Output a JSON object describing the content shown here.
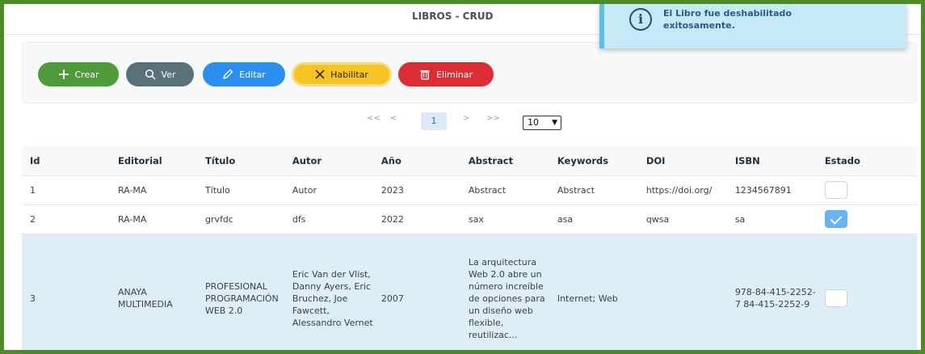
{
  "header": {
    "title": "LIBROS - CRUD"
  },
  "toast": {
    "icon": "info-icon",
    "icon_glyph": "i",
    "message": "El Libro fue deshabilitado exitosamente.",
    "accent": "#5bbde8"
  },
  "toolbar": {
    "crear": "Crear",
    "ver": "Ver",
    "editar": "Editar",
    "habilitar": "Habilitar",
    "eliminar": "Eliminar"
  },
  "pagination": {
    "first": "<<",
    "prev": "<",
    "current_page": "1",
    "next": ">",
    "last": ">>",
    "page_size": "10"
  },
  "table": {
    "headers": [
      "Id",
      "Editorial",
      "Título",
      "Autor",
      "Año",
      "Abstract",
      "Keywords",
      "DOI",
      "ISBN",
      "Estado"
    ],
    "rows": [
      {
        "id": "1",
        "editorial": "RA-MA",
        "titulo": "Título",
        "autor": "Autor",
        "anio": "2023",
        "abstract": "Abstract",
        "keywords": "Abstract",
        "doi": "https://doi.org/",
        "isbn": "1234567891",
        "estado": false
      },
      {
        "id": "2",
        "editorial": "RA-MA",
        "titulo": "grvfdc",
        "autor": "dfs",
        "anio": "2022",
        "abstract": "sax",
        "keywords": "asa",
        "doi": "qwsa",
        "isbn": "sa",
        "estado": true
      },
      {
        "id": "3",
        "editorial": "ANAYA MULTIMEDIA",
        "titulo": "PROFESIONAL PROGRAMACIÓN WEB 2.0",
        "autor": "Eric Van der Vlist, Danny Ayers, Eric Bruchez, Joe Fawcett, Alessandro Vernet",
        "anio": "2007",
        "abstract": "La arquitectura Web 2.0 abre un número increíble de opciones para un diseño web flexible, reutilizac...",
        "keywords": "Internet; Web",
        "doi": "",
        "isbn": "978-84-415-2252-7 84-415-2252-9",
        "estado": false
      }
    ]
  }
}
